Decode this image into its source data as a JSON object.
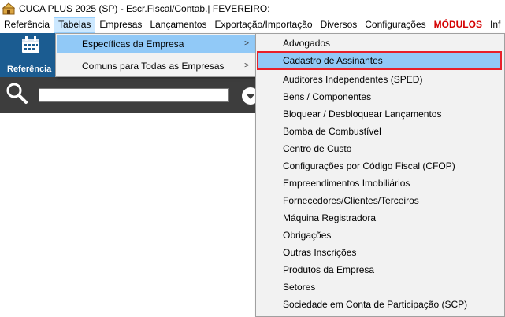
{
  "window": {
    "title": "CUCA PLUS 2025 (SP) - Escr.Fiscal/Contab.| FEVEREIRO:",
    "app_icon": "cuca-app-icon"
  },
  "menubar": {
    "items": [
      "Referência",
      "Tabelas",
      "Empresas",
      "Lançamentos",
      "Exportação/Importação",
      "Diversos",
      "Configurações",
      "MÓDULOS",
      "Inf"
    ],
    "active": "Tabelas"
  },
  "toolbar": {
    "referencia_label": "Referência",
    "referencia_icon": "calendar-icon"
  },
  "search": {
    "value": "",
    "icons": [
      "search-icon",
      "chevron-down-icon"
    ]
  },
  "tabelas_menu": {
    "items": [
      {
        "label": "Específicas da Empresa",
        "arrow": ">",
        "highlighted": true
      },
      {
        "label": "Comuns para Todas as Empresas",
        "arrow": ">",
        "highlighted": false
      }
    ]
  },
  "especificas_menu": {
    "highlighted_index": 1,
    "items": [
      "Advogados",
      "Cadastro de Assinantes",
      "Auditores Independentes (SPED)",
      "Bens / Componentes",
      "Bloquear / Desbloquear Lançamentos",
      "Bomba de Combustível",
      "Centro de Custo",
      "Configurações por Código Fiscal (CFOP)",
      "Empreendimentos Imobiliários",
      "Fornecedores/Clientes/Terceiros",
      "Máquina Registradora",
      "Obrigações",
      "Outras Inscrições",
      "Produtos da Empresa",
      "Setores",
      "Sociedade em Conta de Participação (SCP)"
    ]
  },
  "colors": {
    "highlight": "#91c9f7",
    "highlight_border": "#e8202a",
    "toolbar_blue": "#1b5c91",
    "search_bar": "#3d3d3d",
    "modulos": "#d40000"
  }
}
